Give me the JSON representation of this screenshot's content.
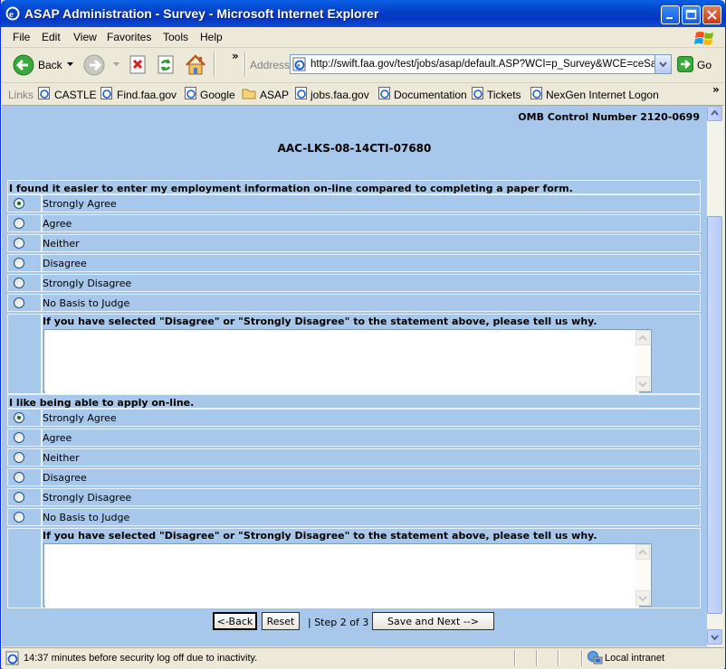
{
  "window": {
    "title": "ASAP Administration - Survey - Microsoft Internet Explorer"
  },
  "menu": [
    "File",
    "Edit",
    "View",
    "Favorites",
    "Tools",
    "Help"
  ],
  "toolbar": {
    "back_label": "Back",
    "address_label": "Address",
    "address_url": "http://swift.faa.gov/test/jobs/asap/default.ASP?WCI=p_Survey&WCE=ceSave",
    "go_label": "Go",
    "overflow_chevron": "»"
  },
  "links": {
    "label": "Links",
    "items": [
      "CASTLE",
      "Find.faa.gov",
      "Google",
      "ASAP",
      "jobs.faa.gov",
      "Documentation",
      "Tickets",
      "NexGen Internet Logon"
    ]
  },
  "page": {
    "omb": "OMB Control Number 2120-0699",
    "survey_id": "AAC-LKS-08-14CTI-07680",
    "options": [
      "Strongly Agree",
      "Agree",
      "Neither",
      "Disagree",
      "Strongly Disagree",
      "No Basis to Judge"
    ],
    "questions": [
      {
        "text": "I found it easier to enter my employment information on-line compared to completing a paper form.",
        "selected": "Strongly Agree",
        "why_label": "If you have selected \"Disagree\" or \"Strongly Disagree\" to the statement above, please tell us why.",
        "why_value": ""
      },
      {
        "text": "I like being able to apply on-line.",
        "selected": "Strongly Agree",
        "why_label": "If you have selected \"Disagree\" or \"Strongly Disagree\" to the statement above, please tell us why.",
        "why_value": ""
      }
    ],
    "buttons": {
      "back": "<-Back",
      "reset": "Reset",
      "step": "| Step 2 of 3 |",
      "save_next": "Save and Next -->"
    }
  },
  "status": {
    "message": "14:37 minutes before security log off due to inactivity.",
    "zone": "Local intranet"
  },
  "colors": {
    "content_bg": "#a7c7eb",
    "titlebar": "#0342c9"
  }
}
